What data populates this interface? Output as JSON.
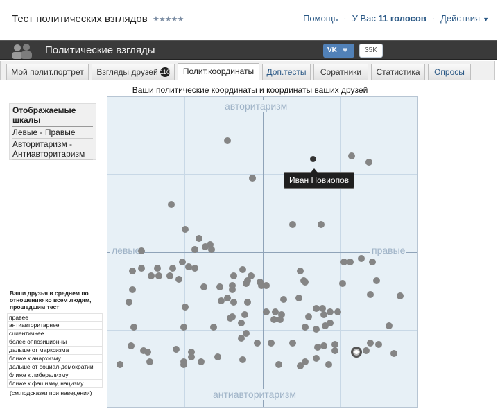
{
  "header": {
    "app_title": "Тест политических взглядов",
    "stars": "★★★★★",
    "help": "Помощь",
    "votes_prefix": "У Вас",
    "votes_count": "11 голосов",
    "actions": "Действия"
  },
  "banner": {
    "title": "Политические взгляды",
    "vk_label": "VK",
    "likes": "35K"
  },
  "tabs": [
    {
      "label": "Мой полит.портрет"
    },
    {
      "label": "Взгляды друзей",
      "badge": "110"
    },
    {
      "label": "Полит.координаты"
    },
    {
      "label": "Доп.тесты"
    },
    {
      "label": "Соратники"
    },
    {
      "label": "Статистика"
    },
    {
      "label": "Опросы"
    }
  ],
  "chart_title": "Ваши политические координаты и координаты ваших друзей",
  "scales": {
    "heading": "Отображаемые шкалы",
    "items": [
      "Левые - Правые",
      "Авторитаризм - Антиавторитаризм"
    ]
  },
  "friends_avg": {
    "heading": "Ваши друзья в среднем по отношению ко всем людям, прошедшим тест",
    "rows": [
      "правее",
      "антиавторитарнее",
      "сциентичнее",
      "более оппозиционны",
      "дальше от марксизма",
      "ближе к анархизму",
      "дальше от социал-демократии",
      "ближе к либерализму",
      "ближе к фашизму, нацизму"
    ],
    "note": "(см.подсказки при наведении)"
  },
  "chart_data": {
    "type": "scatter",
    "title": "Ваши политические координаты и координаты ваших друзей",
    "axis_labels": {
      "top": "авторитаризм",
      "bottom": "антиавторитаризм",
      "left": "левые",
      "right": "правые"
    },
    "xlim": [
      -1,
      1
    ],
    "ylim": [
      -1,
      1
    ],
    "grid": true,
    "highlighted_friend": {
      "name": "Иван Новиопов",
      "x": 0.32,
      "y": 0.6
    },
    "self_point": {
      "x": 0.6,
      "y": -0.64
    },
    "points": [
      [
        -0.23,
        0.72
      ],
      [
        0.57,
        0.62
      ],
      [
        0.68,
        0.58
      ],
      [
        -0.07,
        0.48
      ],
      [
        -0.59,
        0.31
      ],
      [
        0.37,
        0.18
      ],
      [
        0.19,
        0.18
      ],
      [
        -0.5,
        0.15
      ],
      [
        -0.41,
        0.09
      ],
      [
        -0.34,
        0.05
      ],
      [
        -0.37,
        0.04
      ],
      [
        -0.44,
        0.02
      ],
      [
        -0.33,
        0.02
      ],
      [
        -0.78,
        0.01
      ],
      [
        0.56,
        -0.06
      ],
      [
        0.52,
        -0.06
      ],
      [
        0.63,
        -0.04
      ],
      [
        0.7,
        -0.06
      ],
      [
        -0.52,
        -0.06
      ],
      [
        -0.48,
        -0.09
      ],
      [
        -0.78,
        -0.1
      ],
      [
        -0.68,
        -0.1
      ],
      [
        -0.58,
        -0.1
      ],
      [
        -0.44,
        -0.1
      ],
      [
        -0.13,
        -0.11
      ],
      [
        0.24,
        -0.12
      ],
      [
        -0.84,
        -0.12
      ],
      [
        -0.72,
        -0.15
      ],
      [
        -0.67,
        -0.15
      ],
      [
        -0.6,
        -0.15
      ],
      [
        -0.54,
        -0.17
      ],
      [
        -0.19,
        -0.15
      ],
      [
        -0.08,
        -0.15
      ],
      [
        -0.02,
        -0.19
      ],
      [
        0.26,
        -0.18
      ],
      [
        -0.1,
        -0.18
      ],
      [
        -0.2,
        -0.21
      ],
      [
        -0.11,
        -0.2
      ],
      [
        -0.01,
        -0.21
      ],
      [
        0.02,
        -0.21
      ],
      [
        0.27,
        -0.19
      ],
      [
        0.51,
        -0.2
      ],
      [
        0.73,
        -0.18
      ],
      [
        -0.84,
        -0.24
      ],
      [
        -0.38,
        -0.22
      ],
      [
        -0.28,
        -0.22
      ],
      [
        -0.2,
        -0.24
      ],
      [
        0.69,
        -0.27
      ],
      [
        0.88,
        -0.28
      ],
      [
        -0.23,
        -0.29
      ],
      [
        -0.27,
        -0.31
      ],
      [
        -0.86,
        -0.32
      ],
      [
        -0.5,
        -0.35
      ],
      [
        -0.19,
        -0.32
      ],
      [
        -0.1,
        -0.32
      ],
      [
        0.13,
        -0.3
      ],
      [
        0.23,
        -0.29
      ],
      [
        0.34,
        -0.36
      ],
      [
        0.38,
        -0.36
      ],
      [
        0.43,
        -0.38
      ],
      [
        0.48,
        -0.38
      ],
      [
        0.02,
        -0.38
      ],
      [
        0.08,
        -0.38
      ],
      [
        0.12,
        -0.4
      ],
      [
        -0.2,
        -0.41
      ],
      [
        -0.21,
        -0.42
      ],
      [
        -0.12,
        -0.4
      ],
      [
        -0.14,
        -0.45
      ],
      [
        0.07,
        -0.43
      ],
      [
        0.11,
        -0.43
      ],
      [
        0.29,
        -0.41
      ],
      [
        0.39,
        -0.4
      ],
      [
        0.43,
        -0.45
      ],
      [
        -0.83,
        -0.48
      ],
      [
        -0.51,
        -0.48
      ],
      [
        -0.32,
        -0.48
      ],
      [
        0.27,
        -0.48
      ],
      [
        0.4,
        -0.47
      ],
      [
        0.34,
        -0.49
      ],
      [
        0.81,
        -0.47
      ],
      [
        -0.11,
        -0.52
      ],
      [
        -0.85,
        -0.6
      ],
      [
        -0.77,
        -0.63
      ],
      [
        -0.14,
        -0.55
      ],
      [
        -0.04,
        -0.58
      ],
      [
        0.05,
        -0.58
      ],
      [
        0.19,
        -0.58
      ],
      [
        0.35,
        -0.61
      ],
      [
        0.39,
        -0.6
      ],
      [
        0.46,
        -0.59
      ],
      [
        0.46,
        -0.63
      ],
      [
        0.69,
        -0.58
      ],
      [
        0.74,
        -0.59
      ],
      [
        -0.74,
        -0.64
      ],
      [
        -0.56,
        -0.62
      ],
      [
        -0.46,
        -0.64
      ],
      [
        -0.46,
        -0.67
      ],
      [
        -0.29,
        -0.67
      ],
      [
        -0.13,
        -0.69
      ],
      [
        0.27,
        -0.7
      ],
      [
        0.34,
        -0.68
      ],
      [
        0.66,
        -0.63
      ],
      [
        0.84,
        -0.65
      ],
      [
        -0.92,
        -0.72
      ],
      [
        -0.73,
        -0.7
      ],
      [
        -0.51,
        -0.7
      ],
      [
        -0.4,
        -0.7
      ],
      [
        0.1,
        -0.72
      ],
      [
        0.24,
        -0.73
      ],
      [
        0.42,
        -0.72
      ],
      [
        -0.51,
        -0.72
      ]
    ]
  }
}
